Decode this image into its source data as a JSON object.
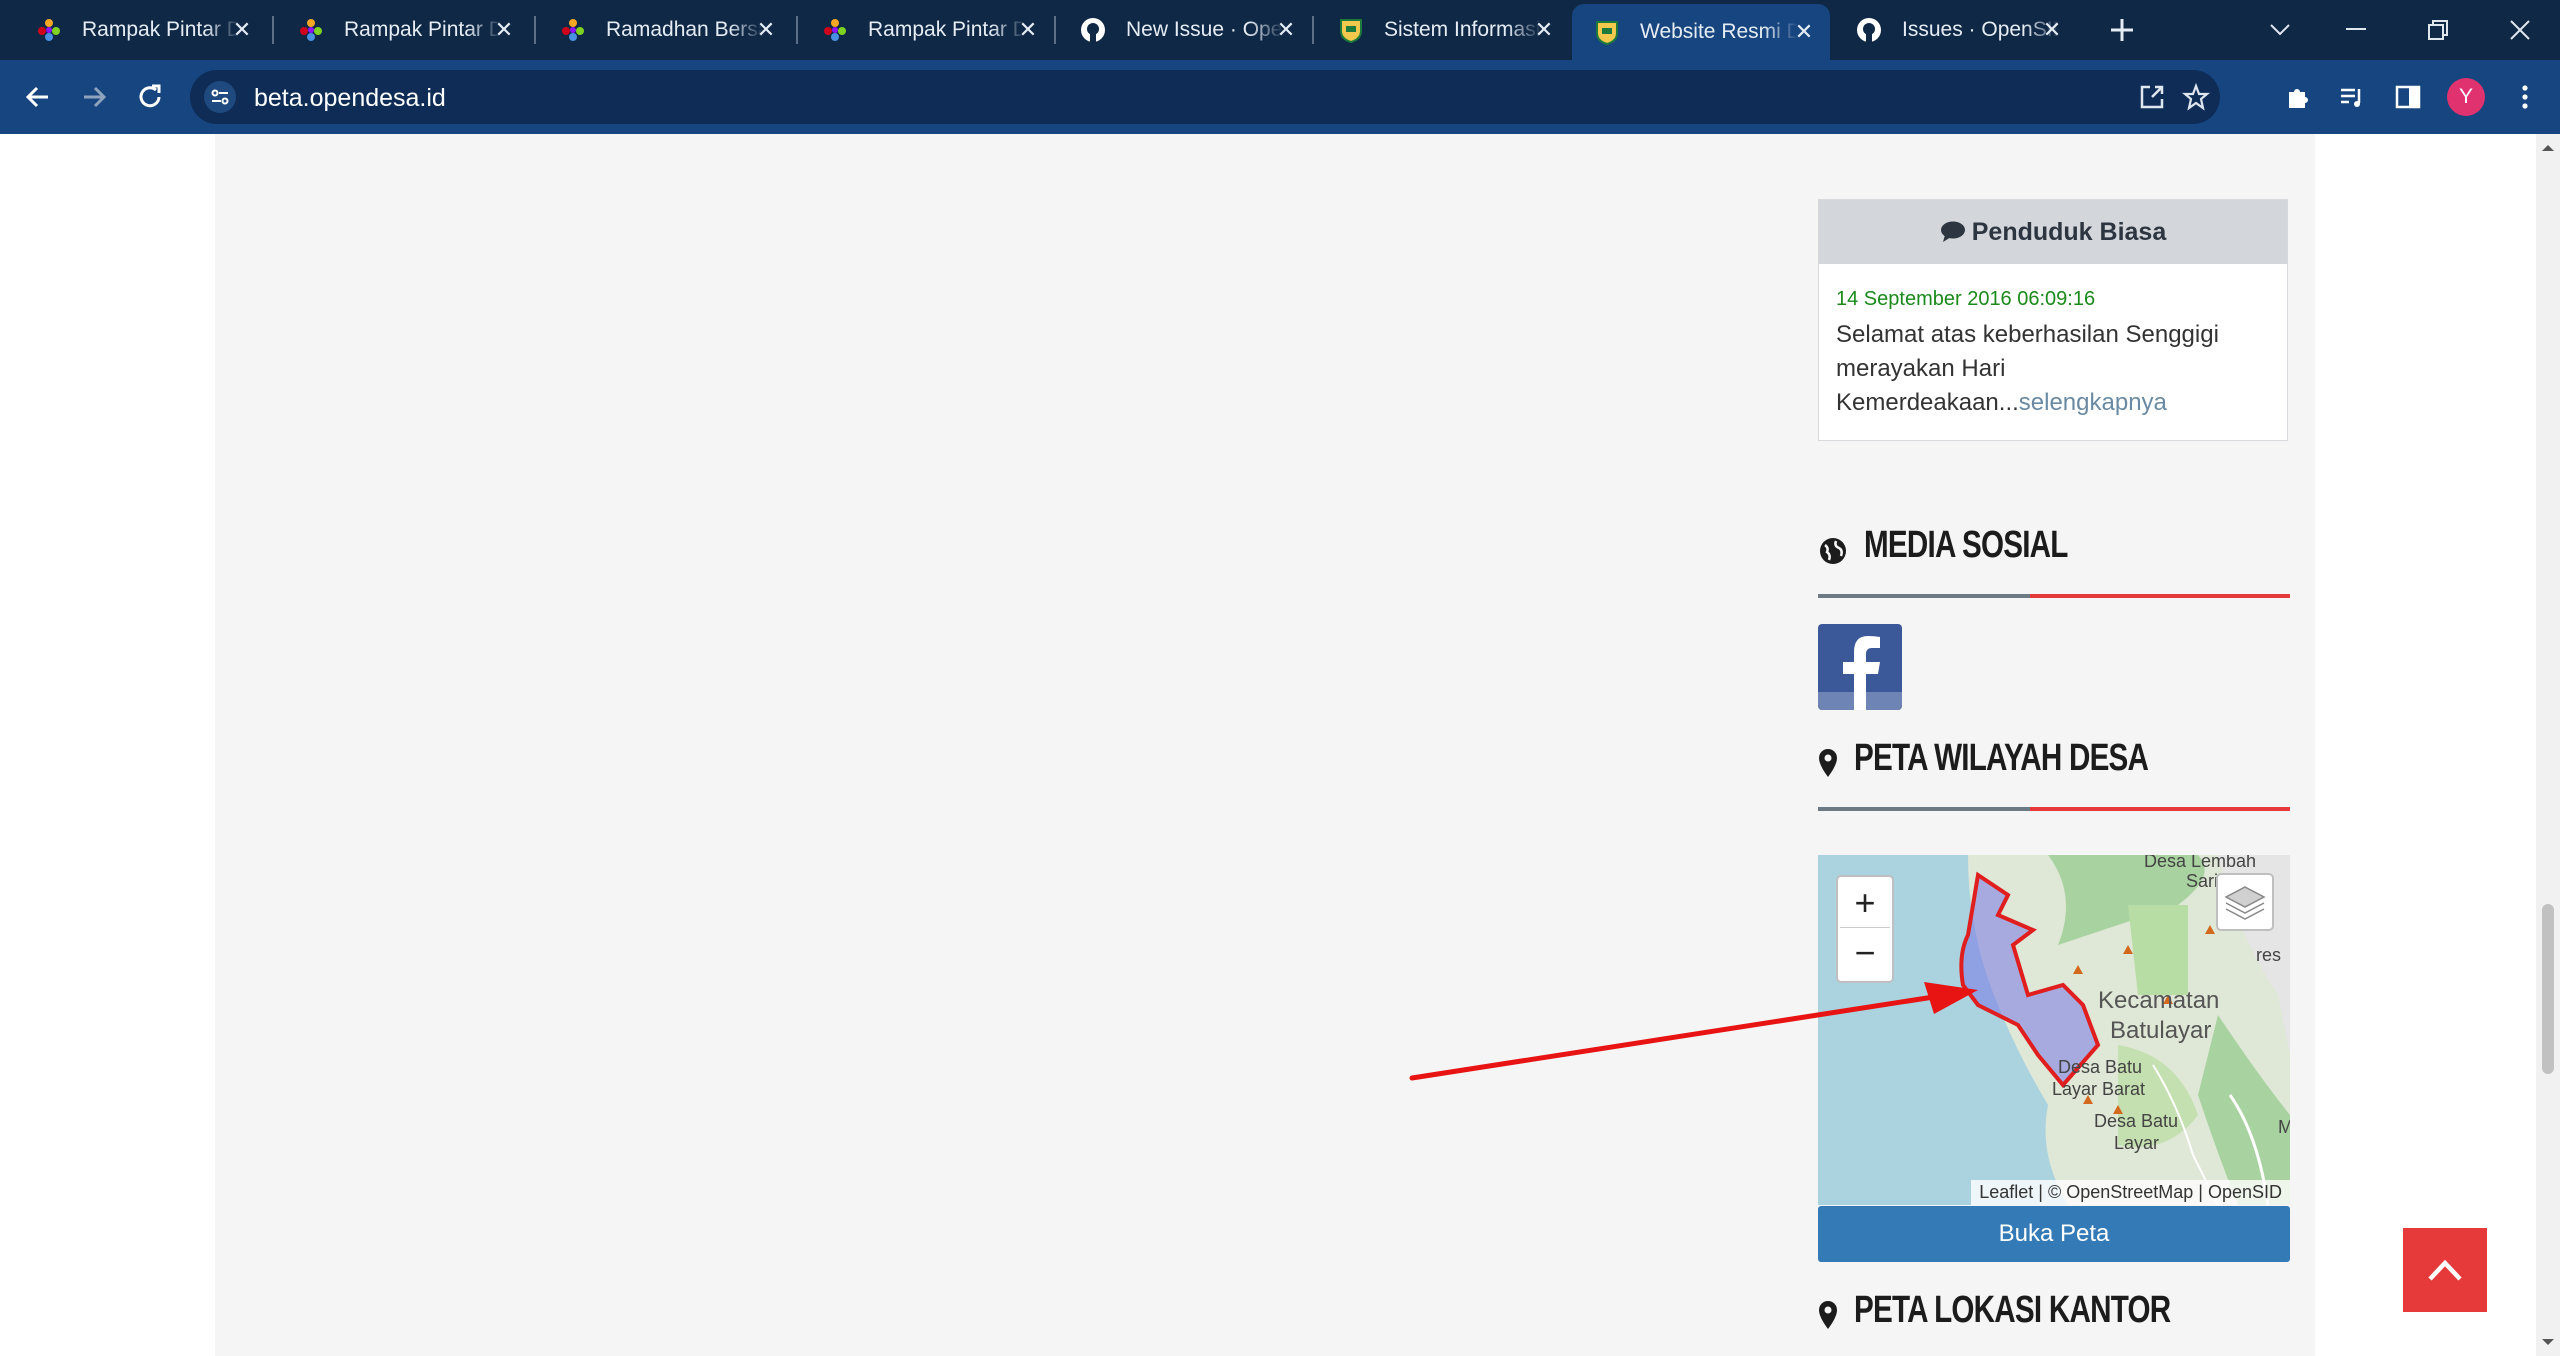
{
  "browser": {
    "tabs": [
      {
        "title": "Rampak Pintar Desa",
        "favicon": "colorful-star-icon",
        "active": false
      },
      {
        "title": "Rampak Pintar Desa",
        "favicon": "colorful-star-icon",
        "active": false
      },
      {
        "title": "Ramadhan Bersama",
        "favicon": "colorful-star-icon",
        "active": false
      },
      {
        "title": "Rampak Pintar Desa",
        "favicon": "colorful-star-icon",
        "active": false
      },
      {
        "title": "New Issue · OpenSID",
        "favicon": "github-icon",
        "active": false
      },
      {
        "title": "Sistem Informasi Desa",
        "favicon": "shield-crest-icon",
        "active": false
      },
      {
        "title": "Website Resmi Desa",
        "favicon": "shield-crest-icon",
        "active": true
      },
      {
        "title": "Issues · OpenSID",
        "favicon": "github-icon",
        "active": false
      }
    ],
    "url": "beta.opendesa.id",
    "avatar_initial": "Y",
    "colors": {
      "tabbar": "#0e2846",
      "toolbar": "#17457f",
      "avatar": "#e0326e"
    }
  },
  "page": {
    "comment": {
      "header": "Penduduk Biasa",
      "date": "14 September 2016 06:09:16",
      "text": "Selamat atas keberhasilan Senggigi merayakan Hari Kemerdeakaan...",
      "more": "selengkapnya"
    },
    "media_sosial": {
      "title": "MEDIA SOSIAL",
      "icon": "globe-icon"
    },
    "facebook": {
      "icon": "facebook-icon"
    },
    "peta_wilayah": {
      "title": "PETA WILAYAH DESA",
      "icon": "map-marker-icon"
    },
    "map": {
      "zoom_in": "+",
      "zoom_out": "−",
      "attribution": "Leaflet | © OpenStreetMap | OpenSID",
      "labels": [
        "Desa Lembah",
        "Sari",
        "Kecamatan",
        "Batulayar",
        "Desa Batu",
        "Layar Barat",
        "Desa Batu",
        "Layar",
        "res",
        "M"
      ]
    },
    "buka_peta": "Buka Peta",
    "peta_lokasi": {
      "title": "PETA LOKASI KANTOR",
      "icon": "map-marker-icon"
    },
    "colors": {
      "accent_red": "#e63a3a",
      "button_blue": "#337ab7",
      "comment_date": "#1a8a1a"
    }
  }
}
